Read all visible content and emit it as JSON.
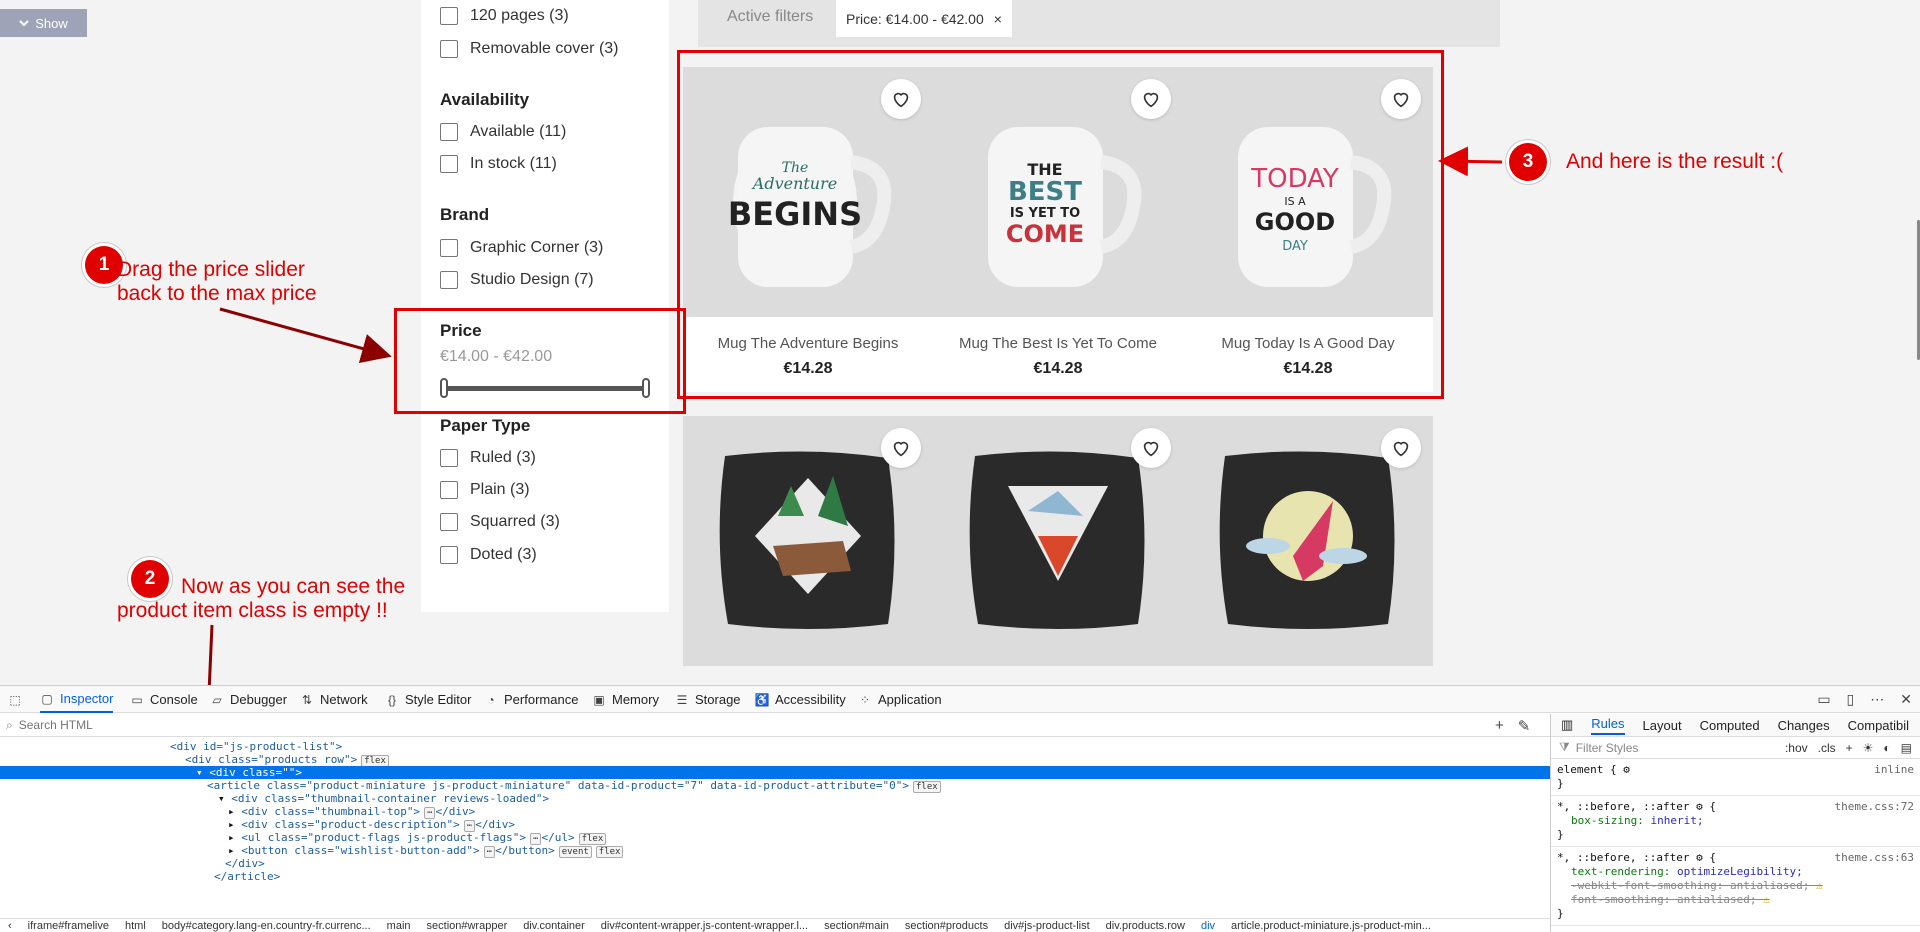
{
  "page": {
    "show_button": "Show",
    "active_filters": {
      "label": "Active filters",
      "chip": "Price: €14.00 - €42.00",
      "chip_remove": "×"
    },
    "filters": {
      "top_items": [
        "120 pages (3)",
        "Removable cover (3)"
      ],
      "availability": {
        "title": "Availability",
        "items": [
          "Available (11)",
          "In stock (11)"
        ]
      },
      "brand": {
        "title": "Brand",
        "items": [
          "Graphic Corner (3)",
          "Studio Design (7)"
        ]
      },
      "price": {
        "title": "Price",
        "range": "€14.00 - €42.00",
        "min_fraction": 0.0,
        "max_fraction": 1.0
      },
      "paper_type": {
        "title": "Paper Type",
        "items": [
          "Ruled (3)",
          "Plain (3)",
          "Squarred (3)",
          "Doted (3)"
        ]
      }
    },
    "products": [
      {
        "name": "Mug The Adventure Begins",
        "price": "€14.28",
        "mug_lines": [
          "The",
          "Adventure",
          "BEGINS"
        ]
      },
      {
        "name": "Mug The Best Is Yet To Come",
        "price": "€14.28",
        "mug_lines": [
          "THE",
          "BEST",
          "IS YET TO",
          "COME"
        ]
      },
      {
        "name": "Mug Today Is A Good Day",
        "price": "€14.28",
        "mug_lines": [
          "TODAY",
          "IS A",
          "GOOD",
          "DAY"
        ]
      }
    ],
    "pillows": [
      "bear",
      "fox",
      "bird"
    ]
  },
  "annotations": {
    "step1": {
      "number": "1",
      "text_line1": "Drag the price slider",
      "text_line2": "back to the max price"
    },
    "step2": {
      "number": "2",
      "text_line1": "Now as you can see the",
      "text_line2": "product item class is empty !!"
    },
    "step3": {
      "number": "3",
      "text": "And here is the result  :("
    },
    "color": "#e00000"
  },
  "devtools": {
    "tabs": [
      "Inspector",
      "Console",
      "Debugger",
      "Network",
      "Style Editor",
      "Performance",
      "Memory",
      "Storage",
      "Accessibility",
      "Application"
    ],
    "active_tab": "Inspector",
    "search_placeholder": "Search HTML",
    "markup": {
      "line0": "<div id=\"js-product-list\">",
      "line1_tag": "<div class=\"products row\">",
      "line1_pill": "flex",
      "line2": "<div class=\"\">",
      "line3_a": "<article class=\"product-miniature js-product-miniature\" data-id-product=\"7\" data-id-product-attribute=\"0\">",
      "line3_pill": "flex",
      "line4": "<div class=\"thumbnail-container reviews-loaded\">",
      "line5": "<div class=\"thumbnail-top\">",
      "line5_end": "</div>",
      "line6": "<div class=\"product-description\">",
      "line6_end": "</div>",
      "line7": "<ul class=\"product-flags js-product-flags\">",
      "line7_end": "</ul>",
      "line7_pill": "flex",
      "line8": "<button class=\"wishlist-button-add\">",
      "line8_end": "</button>",
      "line8_pill1": "event",
      "line8_pill2": "flex",
      "line9": "</div>",
      "line10": "</article>",
      "ellipsis": "⋯"
    },
    "breadcrumbs": [
      "iframe#framelive",
      "html",
      "body#category.lang-en.country-fr.currenc...",
      "main",
      "section#wrapper",
      "div.container",
      "div#content-wrapper.js-content-wrapper.l...",
      "section#main",
      "section#products",
      "div#js-product-list",
      "div.products.row",
      "div",
      "article.product-miniature.js-product-min..."
    ],
    "rules_tabs": [
      "Rules",
      "Layout",
      "Computed",
      "Changes",
      "Compatibil"
    ],
    "filter_placeholder": "Filter Styles",
    "hov": ":hov",
    "cls": ".cls",
    "rules": [
      {
        "selector": "element {",
        "source": "inline",
        "lines": [],
        "close": "}"
      },
      {
        "selector": "*, ::before, ::after",
        "source": "theme.css:72",
        "lines": [
          {
            "p": "box-sizing",
            "v": "inherit;"
          }
        ],
        "close": "}"
      },
      {
        "selector": "*, ::before, ::after",
        "source": "theme.css:63",
        "lines": [
          {
            "p": "text-rendering",
            "v": "optimizeLegibility;"
          },
          {
            "p": "-webkit-font-smoothing",
            "v": "antialiased;"
          },
          {
            "p": "font-smoothing",
            "v": "antialiased;"
          }
        ],
        "close": "}"
      }
    ]
  }
}
